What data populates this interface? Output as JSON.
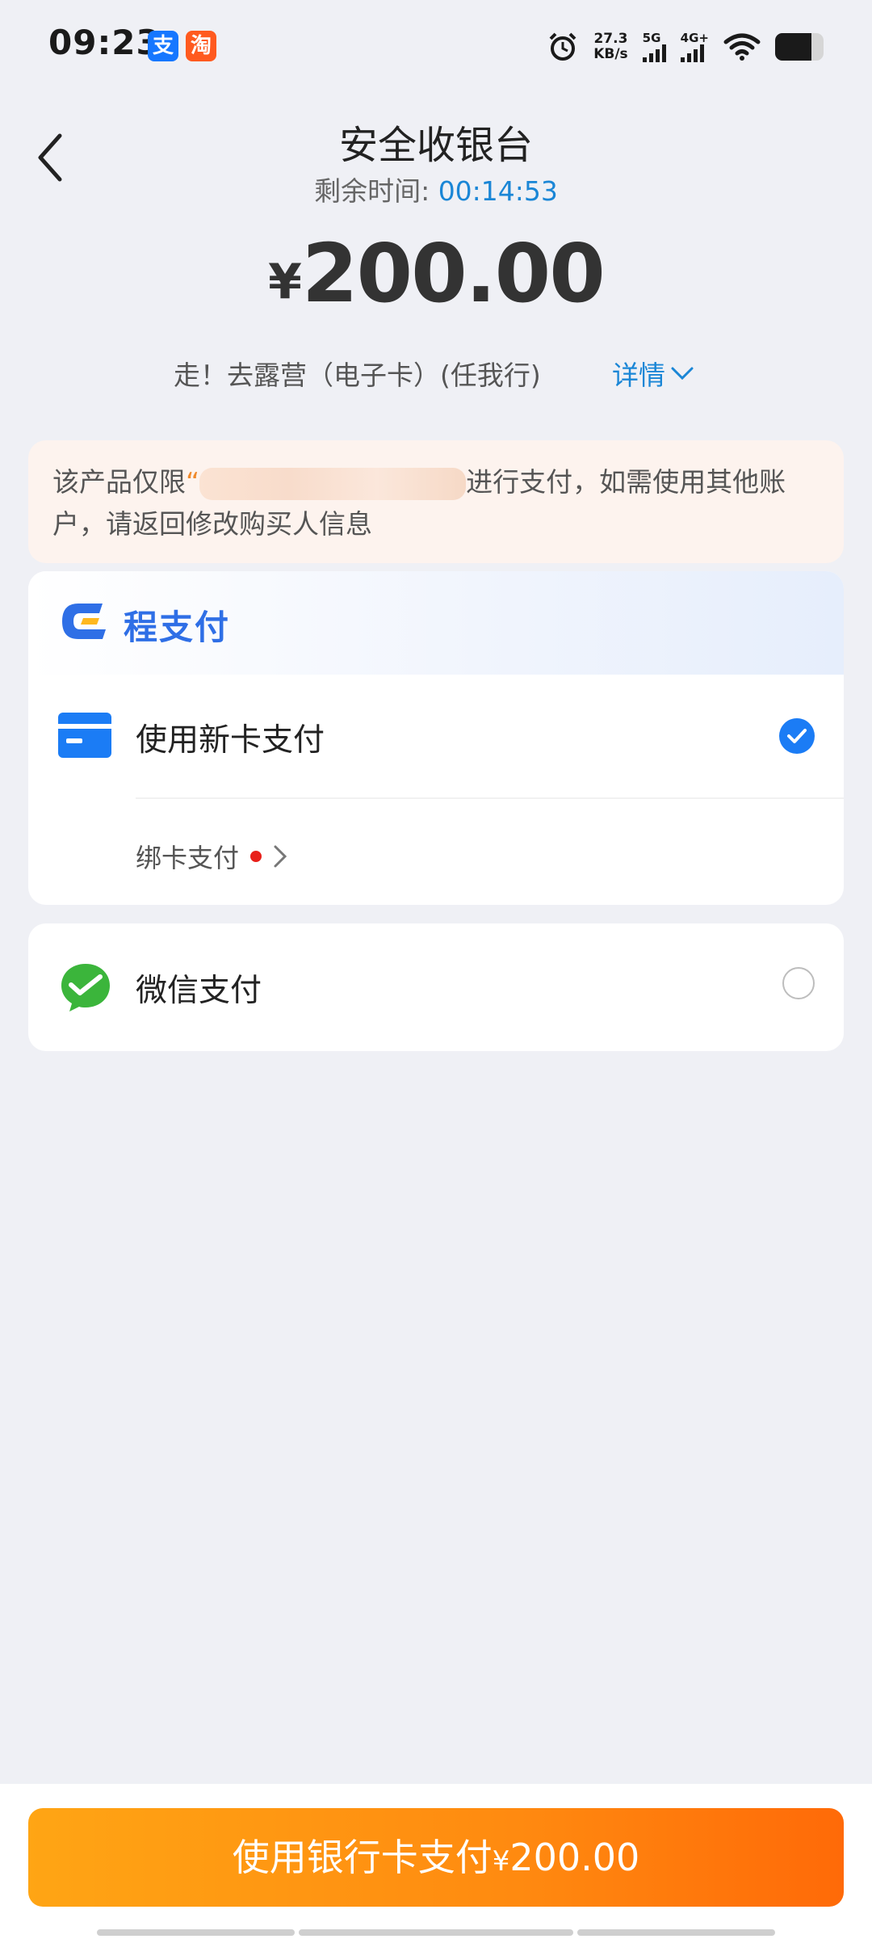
{
  "status_bar": {
    "time": "09:23",
    "alipay_icon_char": "支",
    "taobao_icon_char": "淘",
    "net_speed_value": "27.3",
    "net_speed_unit": "KB/s",
    "signal1_label": "5G",
    "signal2_label": "4G+",
    "battery_level": 0.75
  },
  "header": {
    "title": "安全收银台",
    "timer_label": "剩余时间: ",
    "timer_value": "00:14:53"
  },
  "order": {
    "currency_symbol": "¥",
    "amount": "200.00",
    "product_name": "走！去露营（电子卡）(任我行)",
    "details_label": "详情"
  },
  "notice": {
    "text_before": "该产品仅限",
    "quote_open": "“",
    "text_after": "进行支付，如需使用其他账户，请返回修改购买人信息"
  },
  "payment_section": {
    "brand_name": "程支付",
    "new_card_label": "使用新卡支付",
    "new_card_selected": true,
    "bind_card_label": "绑卡支付"
  },
  "wechat": {
    "label": "微信支付",
    "selected": false
  },
  "pay_button": {
    "label": "使用银行卡支付",
    "currency_symbol": "¥",
    "amount": "200.00"
  },
  "colors": {
    "accent_blue": "#1b7cf5",
    "link_blue": "#1a86d6",
    "button_orange": "#ff8a10",
    "wechat_green": "#3bb53b",
    "background": "#eff0f5"
  }
}
